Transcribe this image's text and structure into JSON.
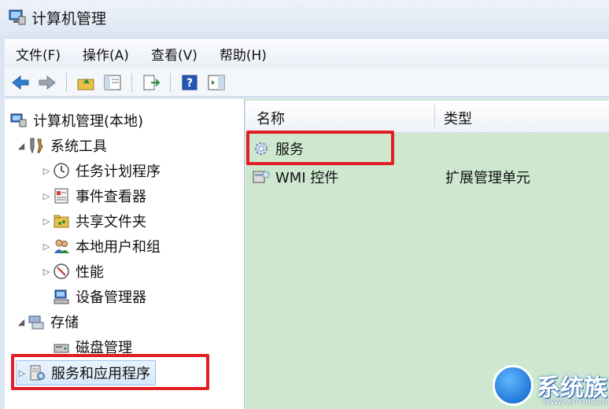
{
  "window": {
    "title": "计算机管理"
  },
  "menubar": {
    "items": [
      "文件(F)",
      "操作(A)",
      "查看(V)",
      "帮助(H)"
    ]
  },
  "toolbar": {
    "buttons": [
      "back-arrow-icon",
      "forward-arrow-icon",
      "up-folder-icon",
      "show-hide-tree-icon",
      "export-list-icon",
      "help-icon",
      "action-pane-icon"
    ]
  },
  "tree": {
    "root": "计算机管理(本地)",
    "system_tools": "系统工具",
    "task_scheduler": "任务计划程序",
    "event_viewer": "事件查看器",
    "shared_folders": "共享文件夹",
    "local_users": "本地用户和组",
    "performance": "性能",
    "device_manager": "设备管理器",
    "storage": "存储",
    "disk_management": "磁盘管理",
    "services_apps": "服务和应用程序"
  },
  "list": {
    "col_name": "名称",
    "col_type": "类型",
    "rows": [
      {
        "name": "服务",
        "type": ""
      },
      {
        "name": "WMI 控件",
        "type": "扩展管理单元"
      }
    ]
  },
  "watermark": {
    "text": "系统族",
    "sub": "WWW.XITONGZU.COM"
  },
  "colors": {
    "highlight_red": "#e01f25",
    "list_bg": "#cde8cf"
  }
}
